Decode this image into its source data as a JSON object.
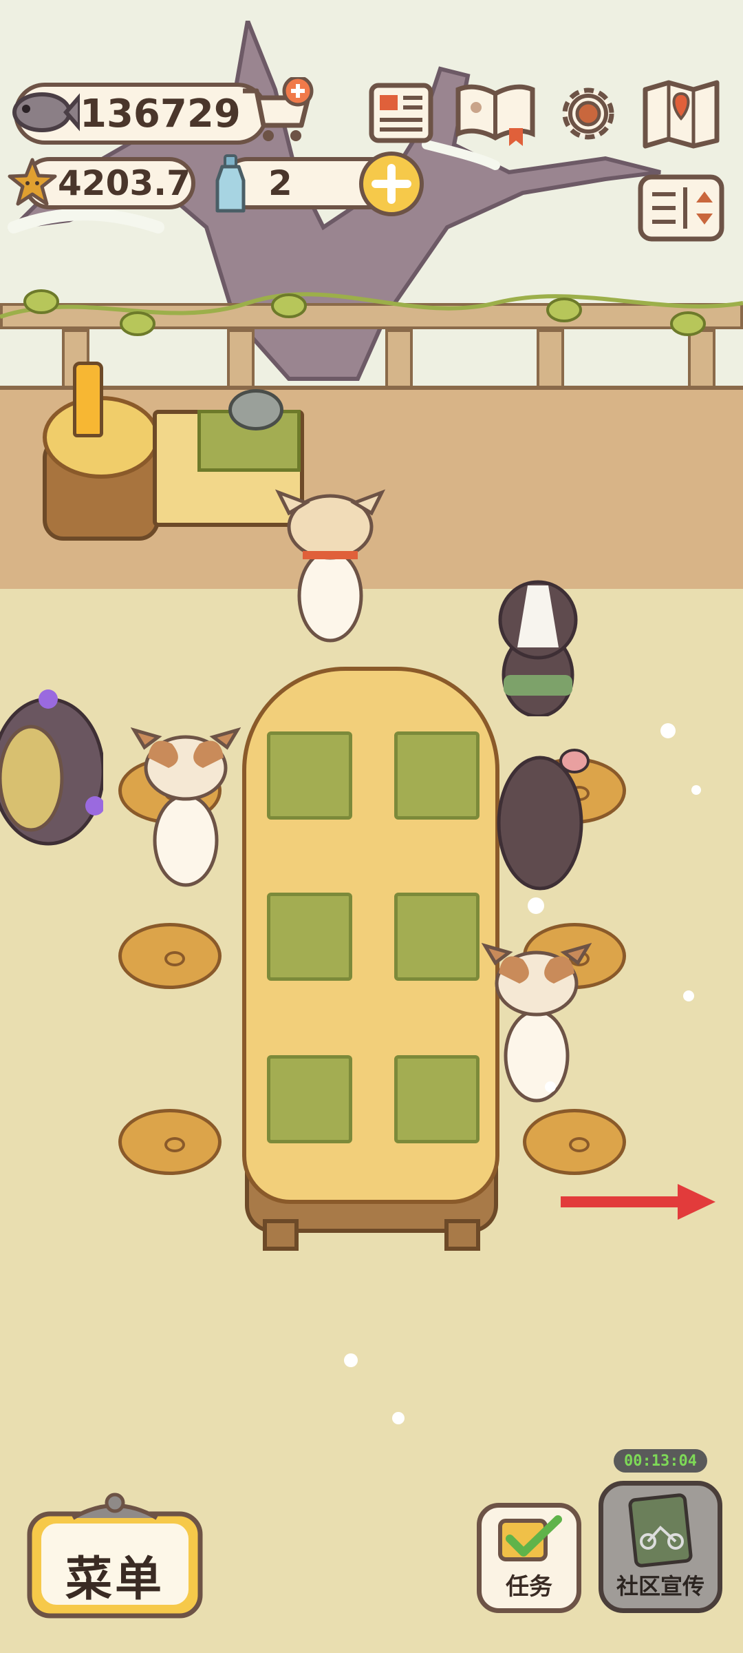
{
  "hud": {
    "fish_count": "136729",
    "star_rating": "4203.7",
    "bottle_count": "2"
  },
  "icons": {
    "fish": "fish-icon",
    "cart": "shop-cart-icon",
    "newspaper": "newspaper-icon",
    "recipe_book": "recipe-book-icon",
    "settings": "gear-icon",
    "map": "map-icon",
    "star": "star-icon",
    "bottle": "bottle-icon",
    "plus": "plus-icon",
    "layout": "layout-toggle-icon"
  },
  "bottom": {
    "menu_label": "菜单",
    "tasks_label": "任务",
    "promo_label": "社区宣传",
    "promo_timer": "00:13:04"
  },
  "colors": {
    "outline": "#6d5346",
    "gold": "#f6c94a",
    "red_arrow": "#e23b3b",
    "timer_green": "#7ed957"
  }
}
